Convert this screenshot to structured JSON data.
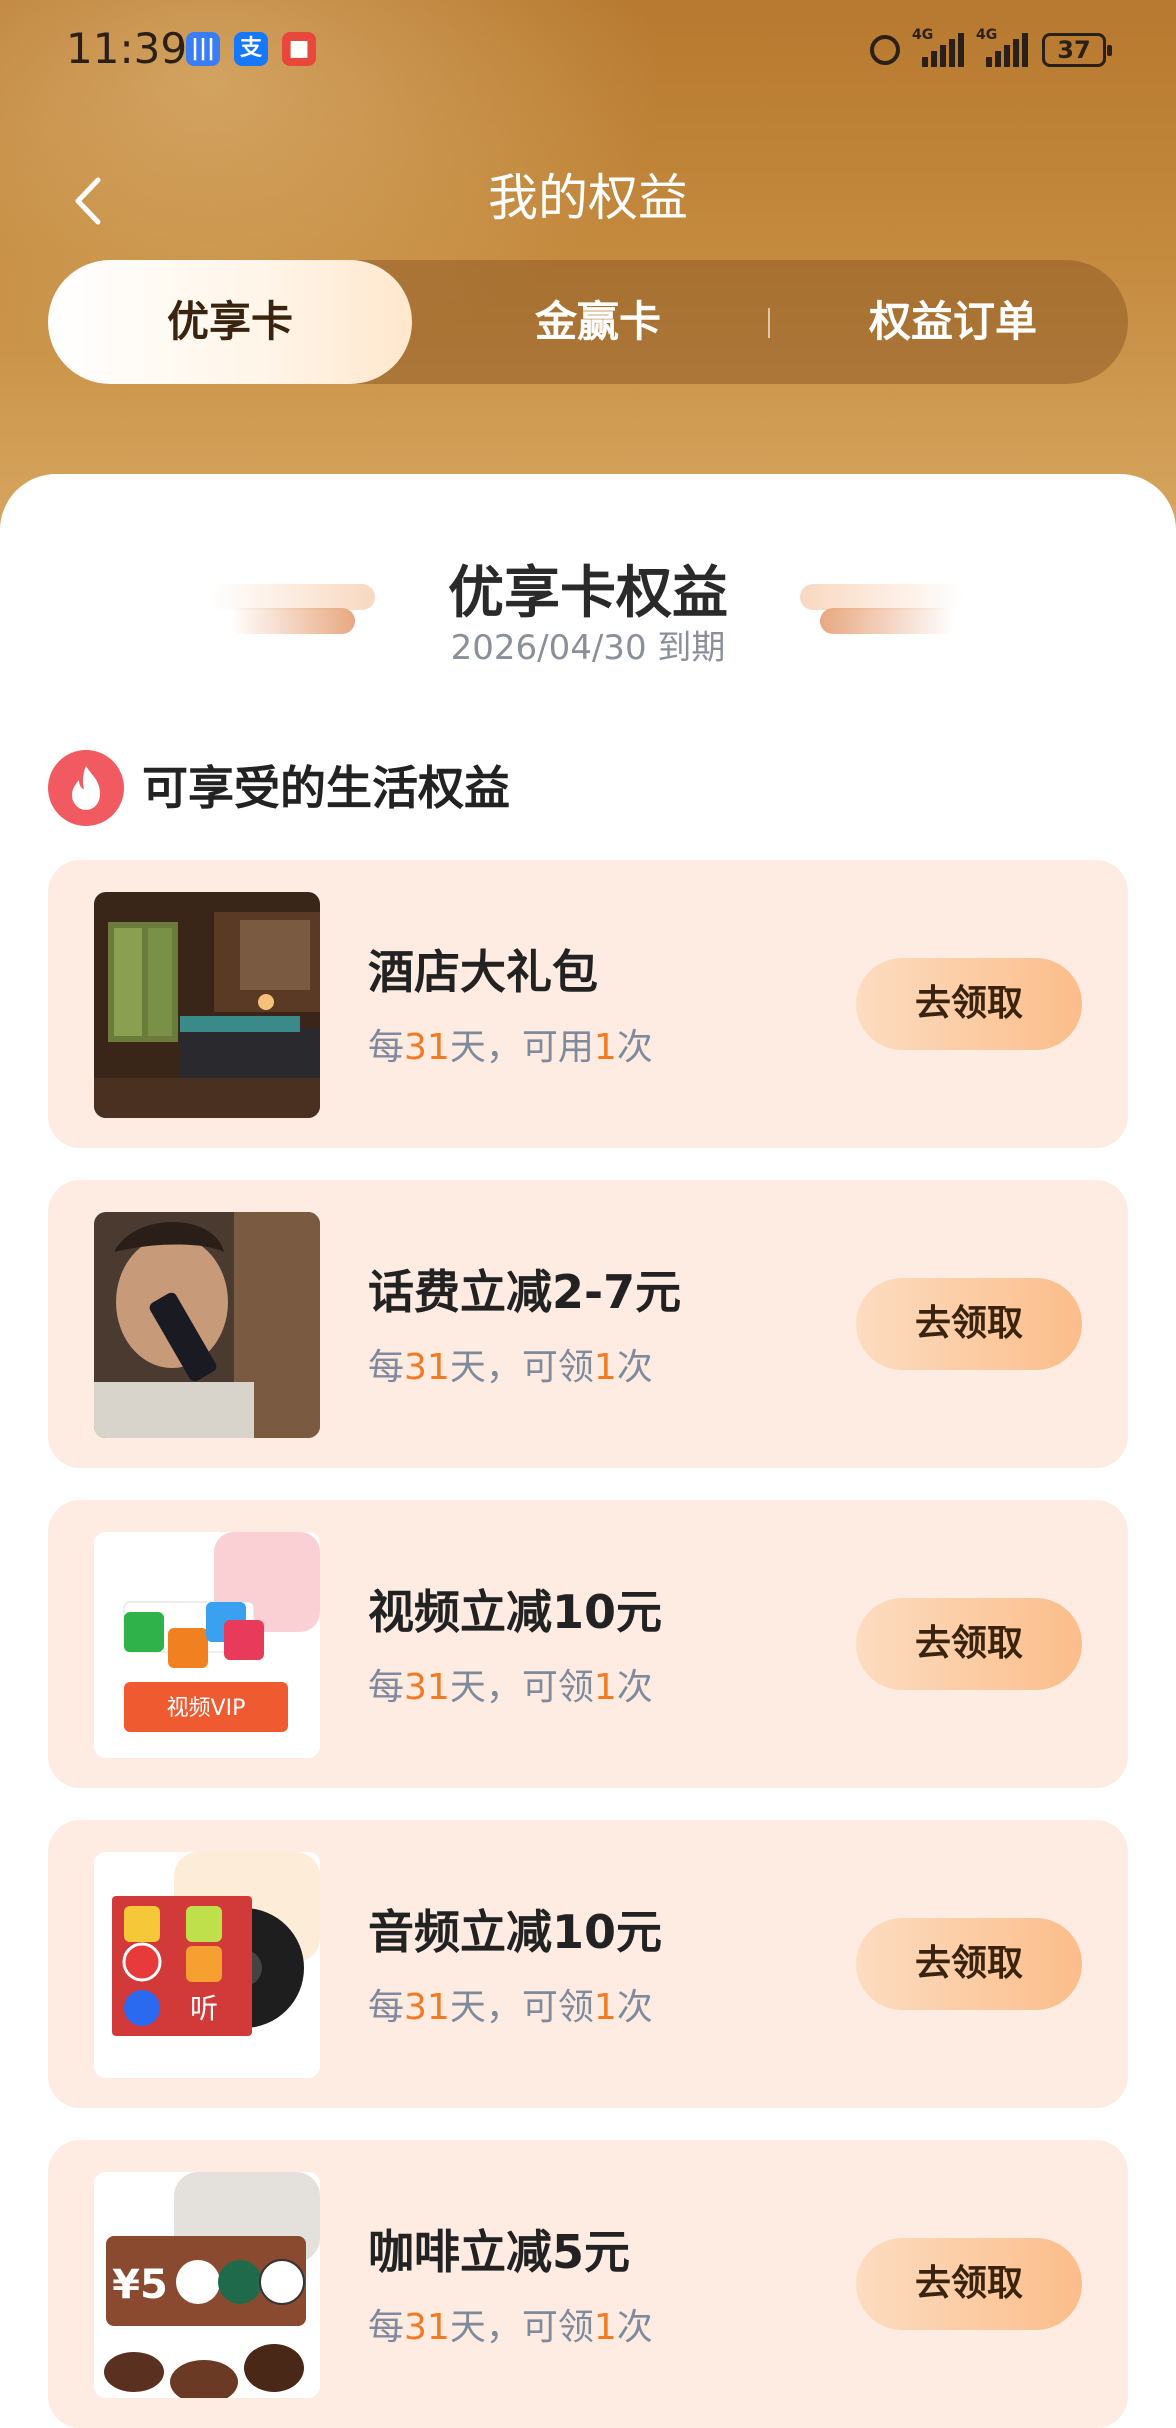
{
  "status_bar": {
    "time": "11:39",
    "sig1_label": "4G",
    "sig2_label": "4G",
    "battery": "37"
  },
  "nav": {
    "title": "我的权益"
  },
  "tabs": [
    {
      "label": "优享卡",
      "active": true
    },
    {
      "label": "金赢卡",
      "active": false
    },
    {
      "label": "权益订单",
      "active": false
    }
  ],
  "card": {
    "title": "优享卡权益",
    "expiry": "2026/04/30 到期"
  },
  "section": {
    "title": "可享受的生活权益"
  },
  "benefits": [
    {
      "title": "酒店大礼包",
      "sub_pre": "每",
      "days": "31",
      "sub_mid": "天，可用",
      "times": "1",
      "sub_post": "次",
      "button": "去领取"
    },
    {
      "title": "话费立减2-7元",
      "sub_pre": "每",
      "days": "31",
      "sub_mid": "天，可领",
      "times": "1",
      "sub_post": "次",
      "button": "去领取"
    },
    {
      "title": "视频立减10元",
      "sub_pre": "每",
      "days": "31",
      "sub_mid": "天，可领",
      "times": "1",
      "sub_post": "次",
      "button": "去领取",
      "thumb_text": "视频VIP"
    },
    {
      "title": "音频立减10元",
      "sub_pre": "每",
      "days": "31",
      "sub_mid": "天，可领",
      "times": "1",
      "sub_post": "次",
      "button": "去领取",
      "thumb_text": "听"
    },
    {
      "title": "咖啡立减5元",
      "sub_pre": "每",
      "days": "31",
      "sub_mid": "天，可领",
      "times": "1",
      "sub_post": "次",
      "button": "去领取",
      "thumb_text": "¥5"
    }
  ],
  "colors": {
    "accent": "#f27a24",
    "header": "#c48a3e",
    "row_bg": "#feece2"
  }
}
